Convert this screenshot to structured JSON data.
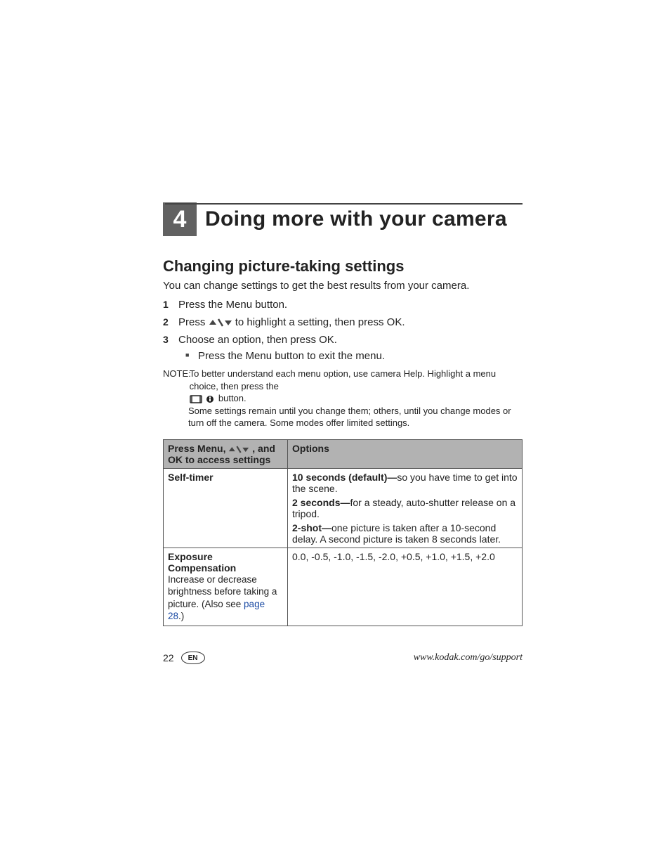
{
  "chapter": {
    "number": "4",
    "title": "Doing more with your camera"
  },
  "section": {
    "title": "Changing picture-taking settings"
  },
  "intro": "You can change settings to get the best results from your camera.",
  "steps": {
    "s1": "Press the Menu button.",
    "s2a": "Press ",
    "s2b": " to highlight a setting, then press OK.",
    "s3": "Choose an option, then press OK.",
    "s3_sub": "Press the Menu button to exit the menu."
  },
  "note": {
    "label": "NOTE:",
    "line1": "To better understand each menu option, use camera Help. Highlight a menu choice, then press the ",
    "button_suffix": " button.",
    "line2": "Some settings remain until you change them; others, until you change modes or turn off the camera. Some modes offer limited settings."
  },
  "table": {
    "header_left_a": "Press Menu, ",
    "header_left_b": ", and OK to access settings",
    "header_right": "Options",
    "rows": {
      "r1": {
        "name": "Self-timer",
        "opt1_b": "10 seconds (default)—",
        "opt1_t": "so you have time to get into the scene.",
        "opt2_b": "2 seconds—",
        "opt2_t": "for a steady, auto-shutter release on a tripod.",
        "opt3_b": "2-shot—",
        "opt3_t": "one picture is taken after a 10-second delay. A second picture is taken 8 seconds later."
      },
      "r2": {
        "name": "Exposure Compensation",
        "desc_a": "Increase or decrease brightness before taking a picture. (Also see ",
        "desc_link": "page 28",
        "desc_b": ".)",
        "values": "0.0, -0.5, -1.0, -1.5, -2.0, +0.5, +1.0, +1.5, +2.0"
      }
    }
  },
  "footer": {
    "page": "22",
    "lang": "EN",
    "url": "www.kodak.com/go/support"
  }
}
